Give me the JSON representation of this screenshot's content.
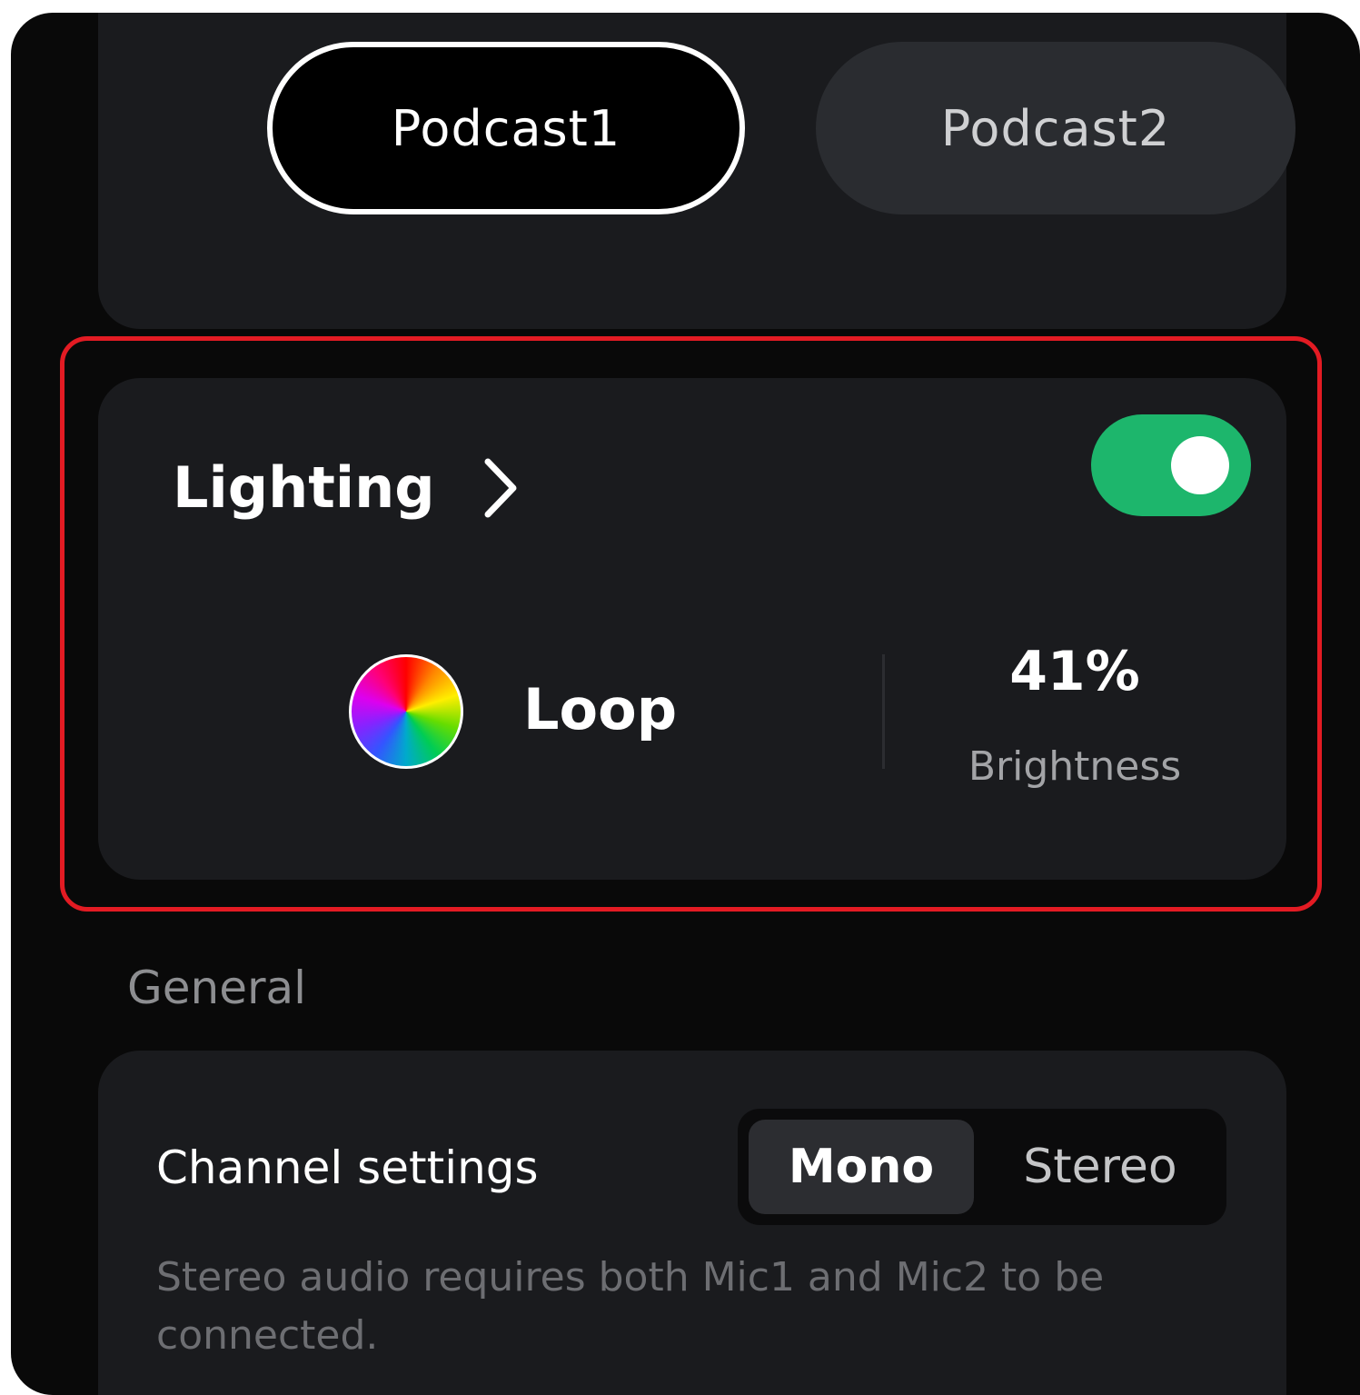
{
  "presets": {
    "items": [
      {
        "label": "Podcast1",
        "active": true
      },
      {
        "label": "Podcast2",
        "active": false
      }
    ]
  },
  "lighting": {
    "title": "Lighting",
    "enabled": true,
    "mode": "Loop",
    "brightness_value": "41%",
    "brightness_label": "Brightness"
  },
  "general": {
    "section_title": "General",
    "channel_settings_label": "Channel settings",
    "options": [
      "Mono",
      "Stereo"
    ],
    "selected": "Mono",
    "note": "Stereo audio requires both Mic1 and Mic2 to be connected."
  },
  "colors": {
    "toggle_on": "#1db66c",
    "highlight_border": "#e31b23",
    "panel_bg": "#1a1b1e",
    "app_bg": "#090909"
  },
  "icons": {
    "chevron": "chevron-right-icon",
    "mode": "color-wheel-icon"
  }
}
